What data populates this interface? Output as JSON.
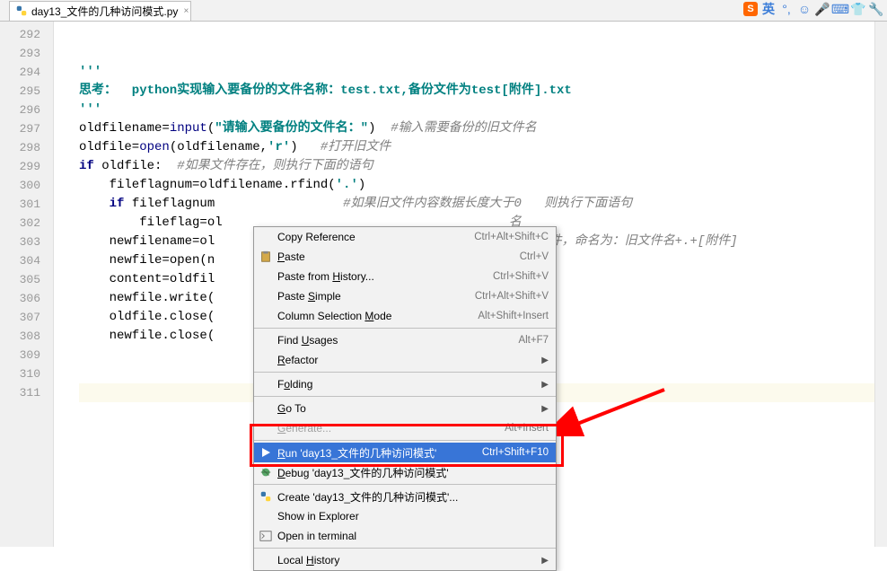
{
  "tab": {
    "filename": "day13_文件的几种访问模式.py"
  },
  "gutter": {
    "start": 292,
    "end": 311
  },
  "code_lines": [
    {
      "t": "plain",
      "txt": ""
    },
    {
      "t": "plain",
      "txt": ""
    },
    {
      "t": "triplequote",
      "txt": "'''"
    },
    {
      "t": "comment_think",
      "prefix": "思考：  ",
      "txt": "python实现输入要备份的文件名称：test.txt,备份文件为test[附件].txt"
    },
    {
      "t": "triplequote",
      "txt": "'''"
    },
    {
      "t": "l297",
      "var": "oldfilename",
      "fn": "input",
      "arg": "\"请输入要备份的文件名：\"",
      "cmt": "#输入需要备份的旧文件名"
    },
    {
      "t": "l298",
      "var": "oldfile",
      "fn": "open",
      "args": "oldfilename,",
      "s": "'r'",
      "cmt": "#打开旧文件"
    },
    {
      "t": "l299",
      "kw": "if",
      "cond": " oldfile:  ",
      "cmt": "#如果文件存在，则执行下面的语句"
    },
    {
      "t": "l300",
      "indent": "    ",
      "var": "fileflagnum",
      "rhs": "oldfilename.rfind(",
      "s": "'.'",
      "tail": ")"
    },
    {
      "t": "l301",
      "indent": "    ",
      "kw": "if",
      "cond": " fileflagnum",
      "cmt_tail": "#如果旧文件内容数据长度大于0   则执行下面语句"
    },
    {
      "t": "l302",
      "indent": "        ",
      "lhs": "fileflag=ol",
      "cmt_tail": "名"
    },
    {
      "t": "l303",
      "indent": "    ",
      "lhs": "newfilename=ol",
      "cmt_tail": "建一个新文件，命名为：旧文件名+.+[附件]"
    },
    {
      "t": "l304",
      "indent": "    ",
      "lhs": "newfile=open(n"
    },
    {
      "t": "l305",
      "indent": "    ",
      "lhs": "content=oldfil"
    },
    {
      "t": "l306",
      "indent": "    ",
      "lhs": "newfile.write("
    },
    {
      "t": "l307",
      "indent": "    ",
      "lhs": "oldfile.close("
    },
    {
      "t": "l308",
      "indent": "    ",
      "lhs": "newfile.close("
    },
    {
      "t": "plain",
      "txt": ""
    },
    {
      "t": "plain",
      "txt": ""
    },
    {
      "t": "caret",
      "txt": ""
    }
  ],
  "menu": [
    {
      "type": "item",
      "label": "Copy Reference",
      "shortcut": "Ctrl+Alt+Shift+C"
    },
    {
      "type": "item",
      "label": "Paste",
      "u": 0,
      "shortcut": "Ctrl+V",
      "icon": "paste"
    },
    {
      "type": "item",
      "label": "Paste from History...",
      "u": 11,
      "shortcut": "Ctrl+Shift+V"
    },
    {
      "type": "item",
      "label": "Paste Simple",
      "u": 6,
      "shortcut": "Ctrl+Alt+Shift+V"
    },
    {
      "type": "item",
      "label": "Column Selection Mode",
      "u": 17,
      "shortcut": "Alt+Shift+Insert"
    },
    {
      "type": "sep"
    },
    {
      "type": "item",
      "label": "Find Usages",
      "u": 5,
      "shortcut": "Alt+F7"
    },
    {
      "type": "item",
      "label": "Refactor",
      "u": 0,
      "sub": true
    },
    {
      "type": "sep"
    },
    {
      "type": "item",
      "label": "Folding",
      "u": 1,
      "sub": true
    },
    {
      "type": "sep"
    },
    {
      "type": "item",
      "label": "Go To",
      "u": 0,
      "sub": true
    },
    {
      "type": "item",
      "label": "Generate...",
      "u": 0,
      "shortcut": "Alt+Insert",
      "disabled": true
    },
    {
      "type": "sep"
    },
    {
      "type": "item",
      "label": "Run 'day13_文件的几种访问模式'",
      "u": 0,
      "shortcut": "Ctrl+Shift+F10",
      "icon": "run",
      "sel": true
    },
    {
      "type": "item",
      "label": "Debug 'day13_文件的几种访问模式'",
      "u": 0,
      "icon": "debug"
    },
    {
      "type": "sep"
    },
    {
      "type": "item",
      "label": "Create 'day13_文件的几种访问模式'...",
      "icon": "py"
    },
    {
      "type": "item",
      "label": "Show in Explorer"
    },
    {
      "type": "item",
      "label": "Open in terminal",
      "icon": "term"
    },
    {
      "type": "sep"
    },
    {
      "type": "item",
      "label": "Local History",
      "u": 6,
      "sub": true
    }
  ],
  "toolbar": {
    "ime": "英"
  }
}
